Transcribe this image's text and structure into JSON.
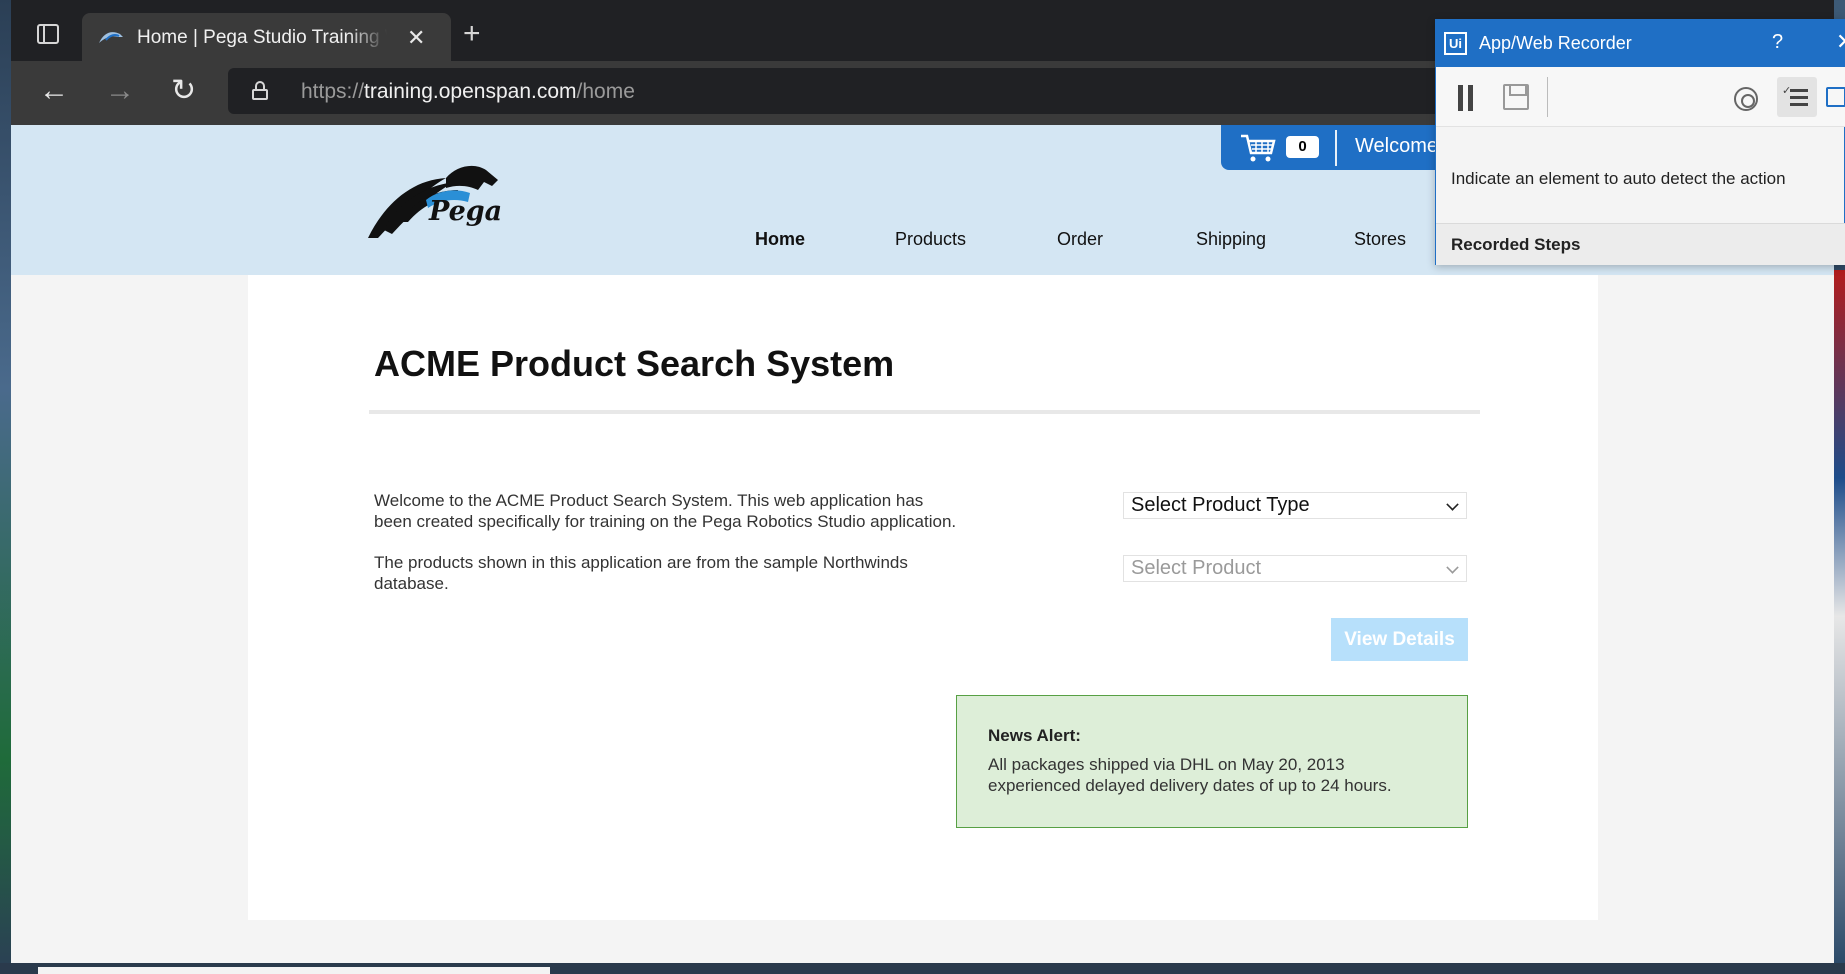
{
  "browser": {
    "tab_title": "Home | Pega Studio Training Web",
    "tab_close": "✕",
    "new_tab": "+",
    "url_scheme": "https://",
    "url_host": "training.openspan.com",
    "url_path": "/home",
    "read_aloud": "A)"
  },
  "site": {
    "logo_text": "Pega",
    "cart_count": "0",
    "welcome": "Welcome",
    "nav": [
      {
        "label": "Home",
        "active": true
      },
      {
        "label": "Products"
      },
      {
        "label": "Order"
      },
      {
        "label": "Shipping"
      },
      {
        "label": "Stores"
      }
    ]
  },
  "main": {
    "title": "ACME Product Search System",
    "intro_p1": "Welcome to the ACME Product Search System. This web application has been created specifically for training on the Pega Robotics Studio application.",
    "intro_p2": "The products shown in this application are from the sample Northwinds database.",
    "product_type_select": "Select Product Type",
    "product_select": "Select Product",
    "view_details": "View Details",
    "news_title": "News Alert:",
    "news_body": "All packages shipped via DHL on May 20, 2013 experienced delayed delivery dates of up to 24 hours."
  },
  "recorder": {
    "logo": "Ui",
    "title": "App/Web Recorder",
    "help": "?",
    "close": "✕",
    "hint": "Indicate an element to auto detect the action",
    "steps_label": "Recorded Steps"
  },
  "colors": {
    "accent_blue": "#1f6fc5",
    "header_bg": "#d4e6f3",
    "news_bg": "#ddeed8",
    "news_border": "#57a044",
    "button_disabled": "#b7e0fb"
  }
}
